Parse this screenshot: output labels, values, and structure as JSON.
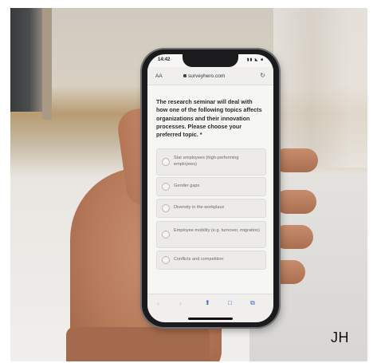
{
  "status_bar": {
    "time": "14:42",
    "icons": "▮▮ ◣ ■"
  },
  "browser": {
    "aa_label": "AA",
    "url": "surveyhero.com"
  },
  "survey": {
    "question": "The research seminar will deal with how one of the following topics affects organizations and their innovation processes. Please choose your preferred topic. *",
    "options": [
      "Star employees (high-performing employees)",
      "Gender gaps",
      "Diversity in the workplace",
      "Employee mobility (e.g. turnover, migration)",
      "Conflicts and competition"
    ]
  },
  "toolbar": {
    "back": "‹",
    "forward": "›",
    "share": "⬆",
    "bookmarks": "□",
    "tabs": "⧉"
  },
  "watermark": "JH",
  "icons": [
    "lock-icon",
    "reload-icon",
    "back-icon",
    "forward-icon",
    "share-icon",
    "bookmarks-icon",
    "tabs-icon"
  ]
}
